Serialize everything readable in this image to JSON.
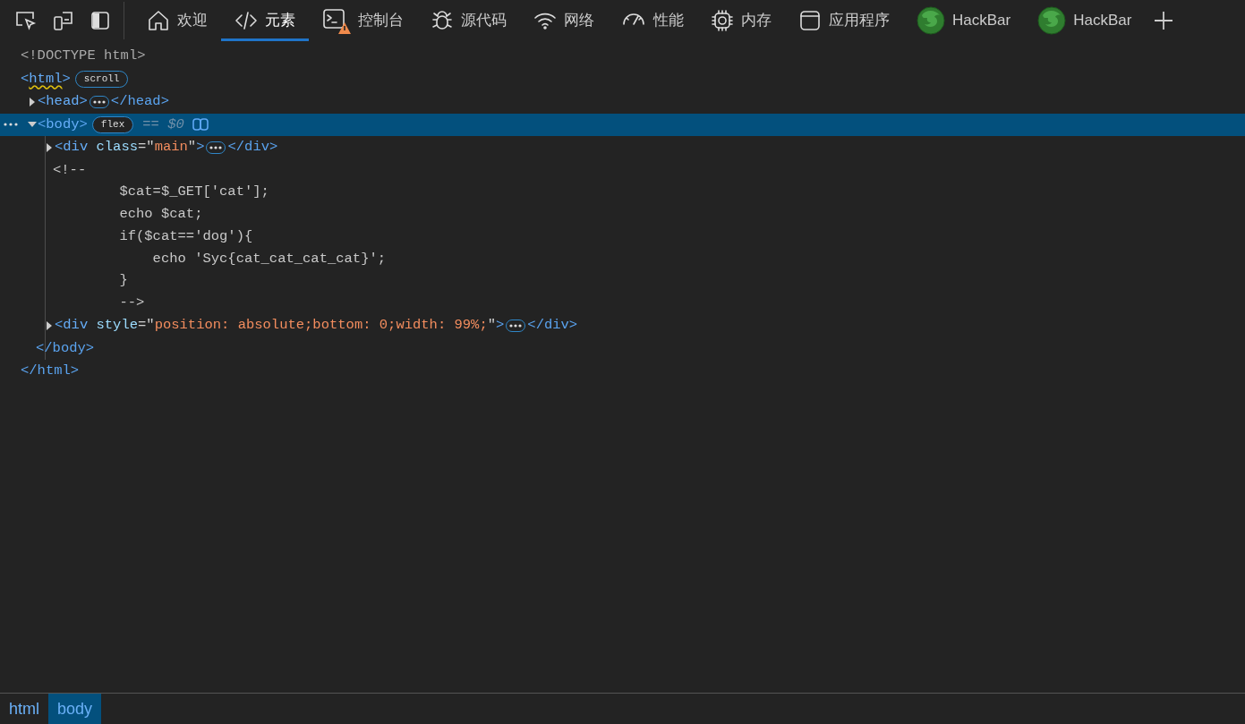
{
  "tabs": [
    {
      "kind": "home",
      "label": "欢迎",
      "selected": false,
      "warning": false
    },
    {
      "kind": "code",
      "label": "元素",
      "selected": true,
      "warning": false
    },
    {
      "kind": "console",
      "label": "控制台",
      "selected": false,
      "warning": true
    },
    {
      "kind": "bug",
      "label": "源代码",
      "selected": false,
      "warning": false
    },
    {
      "kind": "wifi",
      "label": "网络",
      "selected": false,
      "warning": false
    },
    {
      "kind": "gauge",
      "label": "性能",
      "selected": false,
      "warning": false
    },
    {
      "kind": "chip",
      "label": "内存",
      "selected": false,
      "warning": false
    },
    {
      "kind": "window",
      "label": "应用程序",
      "selected": false,
      "warning": false
    },
    {
      "kind": "hackbar",
      "label": "HackBar",
      "selected": false,
      "warning": false
    },
    {
      "kind": "hackbar",
      "label": "HackBar",
      "selected": false,
      "warning": false
    }
  ],
  "tree": [
    {
      "kind": "doctype",
      "text": "<!DOCTYPE html>"
    },
    {
      "kind": "element",
      "expanded": true,
      "selected": false,
      "warning": true,
      "badge": "scroll",
      "open": [
        {
          "kind": "tag",
          "text": "<"
        },
        {
          "kind": "name",
          "text": "html"
        },
        {
          "kind": "tag",
          "text": ">"
        }
      ],
      "close": [
        {
          "kind": "tag",
          "text": "</html>"
        }
      ],
      "children": [
        {
          "kind": "element",
          "expanded": false,
          "selected": false,
          "warning": false,
          "open": [
            {
              "kind": "tag",
              "text": "<"
            },
            {
              "kind": "name",
              "text": "head"
            },
            {
              "kind": "tag",
              "text": ">"
            }
          ],
          "close": [
            {
              "kind": "tag",
              "text": "</head>"
            }
          ]
        },
        {
          "kind": "element",
          "expanded": true,
          "selected": true,
          "warning": false,
          "badge": "flex",
          "reference": "== $0",
          "open": [
            {
              "kind": "tag",
              "text": "<"
            },
            {
              "kind": "name",
              "text": "body"
            },
            {
              "kind": "tag",
              "text": ">"
            }
          ],
          "close": [
            {
              "kind": "tag",
              "text": "</body>"
            }
          ],
          "children": [
            {
              "kind": "element",
              "expanded": false,
              "selected": false,
              "warning": false,
              "open": [
                {
                  "kind": "tag",
                  "text": "<"
                },
                {
                  "kind": "name",
                  "text": "div"
                },
                {
                  "kind": "attr",
                  "text": " class"
                },
                {
                  "kind": "punct",
                  "text": "=\""
                },
                {
                  "kind": "value",
                  "text": "main"
                },
                {
                  "kind": "punct",
                  "text": "\""
                },
                {
                  "kind": "tag",
                  "text": ">"
                }
              ],
              "close": [
                {
                  "kind": "tag",
                  "text": "</div>"
                }
              ]
            },
            {
              "kind": "comment",
              "text": "<!--\n        $cat=$_GET['cat'];\n        echo $cat;\n        if($cat=='dog'){\n            echo 'Syc{cat_cat_cat_cat}';\n        }\n        -->"
            },
            {
              "kind": "element",
              "expanded": false,
              "selected": false,
              "warning": false,
              "open": [
                {
                  "kind": "tag",
                  "text": "<"
                },
                {
                  "kind": "name",
                  "text": "div"
                },
                {
                  "kind": "attr",
                  "text": " style"
                },
                {
                  "kind": "punct",
                  "text": "=\""
                },
                {
                  "kind": "value",
                  "text": "position: absolute;bottom: 0;width: 99%;"
                },
                {
                  "kind": "punct",
                  "text": "\""
                },
                {
                  "kind": "tag",
                  "text": ">"
                }
              ],
              "close": [
                {
                  "kind": "tag",
                  "text": "</div>"
                }
              ]
            }
          ]
        }
      ]
    }
  ],
  "breadcrumbs": [
    {
      "text": "html",
      "selected": false
    },
    {
      "text": "body",
      "selected": true
    }
  ]
}
